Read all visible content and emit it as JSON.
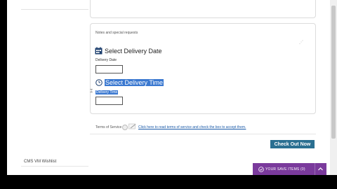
{
  "form": {
    "notes_label": "Notes and special requests",
    "delivery_date": {
      "title": "Select Delivery Date",
      "label": "Delivery Date",
      "value": ""
    },
    "delivery_time": {
      "title": "Select Delivery Time",
      "label": "Delivery Time",
      "value": ""
    }
  },
  "terms": {
    "label": "Terms of Service",
    "link_text": "Click here to read terms of service and check the box to accept them."
  },
  "checkout": {
    "button_label": "Check Out Now"
  },
  "wishlist": {
    "title": "CMS VM Wishlist"
  },
  "save_bar": {
    "label": "YOUR SAVE ITEMS (0)"
  },
  "colors": {
    "checkout_button": "#2a6f91",
    "save_bar": "#7a3a9c",
    "selection_highlight": "#3a78d0",
    "link": "#1a5aa8"
  },
  "icons": [
    "calendar-icon",
    "clock-icon",
    "cursor-icon",
    "checkbox-icon",
    "pencil-icon",
    "check-circle-icon",
    "chevron-up-icon"
  ]
}
